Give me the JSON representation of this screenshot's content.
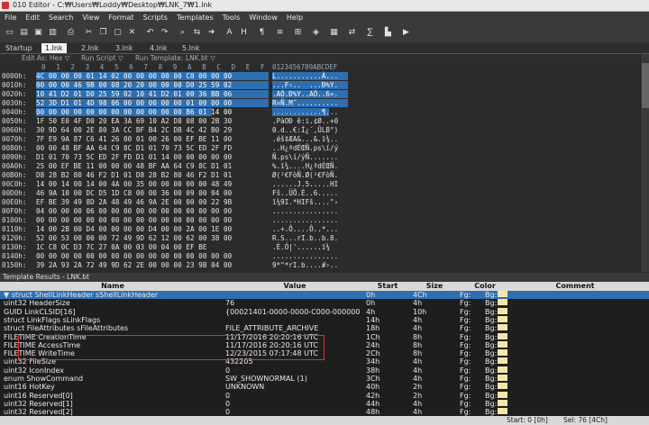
{
  "window": {
    "title": "010 Editor - C:₩Users₩Loddy₩Desktop₩LNK_7₩1.lnk"
  },
  "menu": [
    "File",
    "Edit",
    "Search",
    "View",
    "Format",
    "Scripts",
    "Templates",
    "Tools",
    "Window",
    "Help"
  ],
  "tabs": [
    "Startup",
    "1.lnk",
    "2.lnk",
    "3.lnk",
    "4.lnk",
    "5.lnk"
  ],
  "active_tab": 1,
  "editbar": {
    "edit_as": "Edit As: Hex ▽",
    "run_script": "Run Script ▽",
    "run_template": "Run Template: LNK.bt ▽"
  },
  "hex_header": {
    "cols": [
      "0",
      "1",
      "2",
      "3",
      "4",
      "5",
      "6",
      "7",
      "8",
      "9",
      "A",
      "B",
      "C",
      "D",
      "E",
      "F"
    ],
    "ascii_header": "0123456789ABCDEF"
  },
  "hex_rows": [
    {
      "off": "0000h:",
      "bytes": "4C 00 00 00 01 14 02 00 00 00 00 00 C0 00 00 00",
      "ascii": "L...........À...",
      "sel": "all"
    },
    {
      "off": "0010h:",
      "bytes": "00 00 00 46 9B 00 08 20 20 00 00 00 D0 25 59 02",
      "ascii": "...F›..  ...Ð%Y.",
      "sel": "all"
    },
    {
      "off": "0020h:",
      "bytes": "10 41 D2 01 D0 25 59 02 10 41 D2 01 00 36 BB 06",
      "ascii": ".AÒ.Ð%Y..AÒ..6».",
      "sel": "all"
    },
    {
      "off": "0030h:",
      "bytes": "52 3D D1 01 4D 98 06 00 00 00 00 00 01 00 00 00",
      "ascii": "R=Ñ.M˜..........",
      "sel": "all"
    },
    {
      "off": "0040h:",
      "bytes": "00 00 00 00 00 00 00 00 00 00 00 00 B6 01 14 00",
      "ascii": "............¶...",
      "sel": "part"
    },
    {
      "off": "0050h:",
      "bytes": "1F 50 E0 4F D0 20 EA 3A 69 10 A2 D8 08 00 2B 30",
      "ascii": ".PàOÐ ê:i.¢Ø..+0",
      "sel": "none"
    },
    {
      "off": "0060h:",
      "bytes": "30 9D 64 00 2E 80 3A CC BF B4 2C DB 4C 42 B0 29",
      "ascii": "0.d..€:Ì¿´,ÛLB°)",
      "sel": "none"
    },
    {
      "off": "0070h:",
      "bytes": "7F E9 9A 87 C6 41 26 00 01 00 26 00 EF BE 11 00",
      "ascii": ".éš‡ÆA&...&.ï¾..",
      "sel": "none"
    },
    {
      "off": "0080h:",
      "bytes": "00 00 48 BF AA 64 C9 8C D1 01 70 73 5C ED 2F FD",
      "ascii": "..H¿ªdÉŒÑ.ps\\í/ý",
      "sel": "none"
    },
    {
      "off": "0090h:",
      "bytes": "D1 01 70 73 5C ED 2F FD D1 01 14 00 00 00 00 00",
      "ascii": "Ñ.ps\\í/ýÑ.......",
      "sel": "none"
    },
    {
      "off": "00A0h:",
      "bytes": "25 00 EF BE 11 00 00 00 48 BF AA 64 C9 8C D1 01",
      "ascii": "%.ï¾....H¿ªdÉŒÑ.",
      "sel": "none"
    },
    {
      "off": "00B0h:",
      "bytes": "D8 28 B2 80 46 F2 D1 01 D8 28 B2 80 46 F2 D1 01",
      "ascii": "Ø(²€FòÑ.Ø(²€FòÑ.",
      "sel": "none"
    },
    {
      "off": "00C0h:",
      "bytes": "14 00 14 00 14 00 4A 00 35 00 00 00 00 00 48 49",
      "ascii": "......J.5.....HI",
      "sel": "none"
    },
    {
      "off": "00D0h:",
      "bytes": "46 9A 10 00 DC D5 1D C8 00 00 36 00 09 00 04 00",
      "ascii": "Fš..ÜÕ.È..6.....",
      "sel": "none"
    },
    {
      "off": "00E0h:",
      "bytes": "EF BE 39 49 8D 2A 48 49 46 9A 2E 00 00 00 22 9B",
      "ascii": "ï¾9I.*HIFš....\"›",
      "sel": "none"
    },
    {
      "off": "00F0h:",
      "bytes": "04 00 00 00 06 00 00 00 00 00 00 00 00 00 00 00",
      "ascii": "................",
      "sel": "none"
    },
    {
      "off": "0100h:",
      "bytes": "00 00 00 00 00 00 00 00 00 00 00 00 00 00 00 00",
      "ascii": "................",
      "sel": "none"
    },
    {
      "off": "0110h:",
      "bytes": "14 00 2B 00 D4 00 00 00 00 D4 00 00 2A 00 1E 00",
      "ascii": "..+.Ô....Ô..*...",
      "sel": "none"
    },
    {
      "off": "0120h:",
      "bytes": "52 00 53 00 00 00 72 49 9D 62 12 00 62 00 38 00",
      "ascii": "R.S...rI.b..b.8.",
      "sel": "none"
    },
    {
      "off": "0130h:",
      "bytes": "1C C8 0C D3 7C 27 0A 00 03 00 04 00 EF BE",
      "ascii": ".È.Ó|'......ï¾",
      "sel": "none"
    },
    {
      "off": "0140h:",
      "bytes": "00 00 00 00 00 00 00 00 00 00 00 00 00 00 00 00",
      "ascii": "................",
      "sel": "none"
    },
    {
      "off": "0150h:",
      "bytes": "39 2A 93 2A 72 49 9D 62 2E 00 00 00 23 9B 04 00",
      "ascii": "9*\"*rI.b....#›..",
      "sel": "none"
    }
  ],
  "template_results": {
    "title": "Template Results - LNK.bt",
    "columns": {
      "name": "Name",
      "value": "Value",
      "start": "Start",
      "size": "Size",
      "color": "Color",
      "comment": "Comment"
    },
    "rows": [
      {
        "name": "▼ struct ShellLinkHeader sShellLinkHeader",
        "value": "",
        "start": "0h",
        "size": "4Ch",
        "fg": "Fg:",
        "bg": "Bg:",
        "hl": true
      },
      {
        "name": "    uint32 HeaderSize",
        "value": "76",
        "start": "0h",
        "size": "4h",
        "fg": "Fg:",
        "bg": "Bg:"
      },
      {
        "name": "    GUID LinkCLSID[16]",
        "value": "{00021401-0000-0000-C000-000000000046}",
        "start": "4h",
        "size": "10h",
        "fg": "Fg:",
        "bg": "Bg:"
      },
      {
        "name": "    struct LinkFlags sLinkFlags",
        "value": "",
        "start": "14h",
        "size": "4h",
        "fg": "Fg:",
        "bg": "Bg:"
      },
      {
        "name": "    struct FileAttributes sFileAttributes",
        "value": "FILE_ATTRIBUTE_ARCHIVE",
        "start": "18h",
        "size": "4h",
        "fg": "Fg:",
        "bg": "Bg:"
      },
      {
        "name": "    FILETIME CreationTime",
        "value": "11/17/2016 20:20:16 UTC",
        "start": "1Ch",
        "size": "8h",
        "fg": "Fg:",
        "bg": "Bg:"
      },
      {
        "name": "    FILETIME AccessTime",
        "value": "11/17/2016 20:20:16 UTC",
        "start": "24h",
        "size": "8h",
        "fg": "Fg:",
        "bg": "Bg:"
      },
      {
        "name": "    FILETIME WriteTime",
        "value": "12/23/2015 07:17:48 UTC",
        "start": "2Ch",
        "size": "8h",
        "fg": "Fg:",
        "bg": "Bg:"
      },
      {
        "name": "    uint32 FileSize",
        "value": "432205",
        "start": "34h",
        "size": "4h",
        "fg": "Fg:",
        "bg": "Bg:"
      },
      {
        "name": "    uint32 IconIndex",
        "value": "0",
        "start": "38h",
        "size": "4h",
        "fg": "Fg:",
        "bg": "Bg:"
      },
      {
        "name": "    enum ShowCommand",
        "value": "SW_SHOWNORMAL (1)",
        "start": "3Ch",
        "size": "4h",
        "fg": "Fg:",
        "bg": "Bg:"
      },
      {
        "name": "    uint16 HotKey",
        "value": "UNKNOWN",
        "start": "40h",
        "size": "2h",
        "fg": "Fg:",
        "bg": "Bg:"
      },
      {
        "name": "    uint16 Reserved[0]",
        "value": "0",
        "start": "42h",
        "size": "2h",
        "fg": "Fg:",
        "bg": "Bg:"
      },
      {
        "name": "    uint32 Reserved[1]",
        "value": "0",
        "start": "44h",
        "size": "4h",
        "fg": "Fg:",
        "bg": "Bg:"
      },
      {
        "name": "    uint32 Reserved[2]",
        "value": "0",
        "start": "48h",
        "size": "4h",
        "fg": "Fg:",
        "bg": "Bg:"
      }
    ]
  },
  "status": {
    "start": "Start: 0 [0h]",
    "sel": "Sel: 76 [4Ch]"
  },
  "colors": {
    "selection": "#2f6fb0",
    "highlight_box": "#e0302a",
    "bg_swatch": "#f4e6a8"
  }
}
